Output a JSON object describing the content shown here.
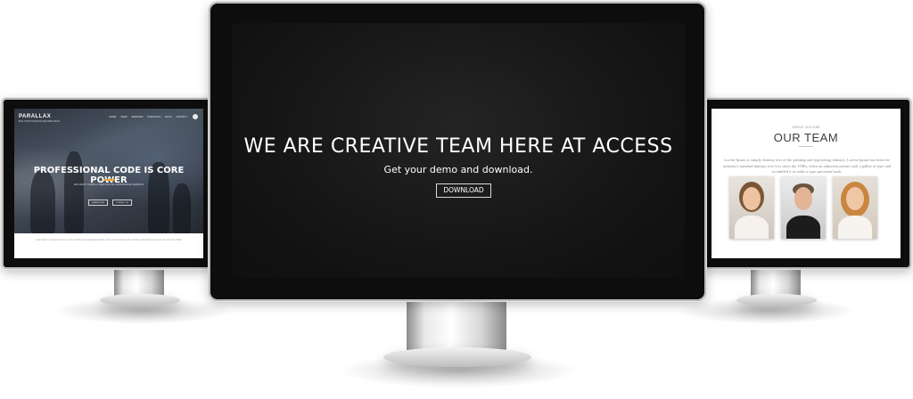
{
  "center": {
    "headline": "WE ARE CREATIVE TEAM HERE AT ACCESS",
    "subline": "Get your demo and download.",
    "button_label": "DOWNLOAD"
  },
  "left": {
    "brand": "PARALLAX",
    "brand_sub": "BUILT WITH PASSION AND PRECISION",
    "nav": [
      "HOME",
      "TEAM",
      "SERVICES",
      "PORTFOLIO",
      "BLOG",
      "CONTACT"
    ],
    "headline": "PROFESSIONAL CODE IS CORE POWER",
    "tagline": "WE CRAFT FRESH & NEW DIGITAL EXPERIENCE WEBSITE",
    "buttons": [
      "LEARN MORE",
      "CONTACT US"
    ],
    "footer_text": "Lorem Ipsum is simply dummy text of the printing and typesetting industry. Lorem Ipsum has been the industry's standard dummy text ever since the 1500s."
  },
  "right": {
    "kicker": "GROUP CULTURE",
    "title": "OUR TEAM",
    "body": "Lorem Ipsum is simply dummy text of the printing and typesetting industry. Lorem Ipsum has been the industry's standard dummy text ever since the 1500s, when an unknown printer took a galley of type and scrambled it to make a type specimen book."
  },
  "colors": {
    "accent_orange": "#f0a030",
    "screen_dark": "#141414",
    "bezel": "#0d0d0d"
  }
}
